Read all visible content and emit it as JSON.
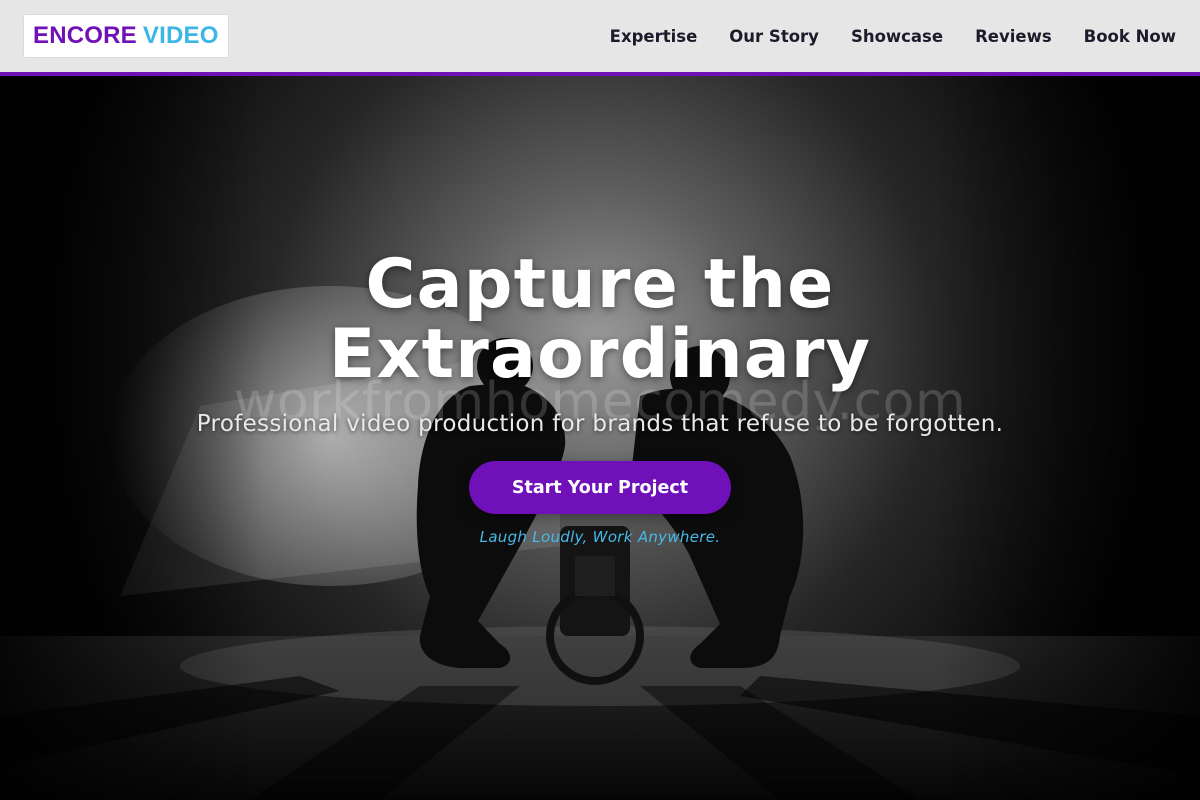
{
  "header": {
    "logo": {
      "word1": "ENCORE",
      "word2": "VIDEO",
      "word1_color": "#7010b8",
      "word2_color": "#3cb6e6"
    },
    "nav": [
      {
        "label": "Expertise"
      },
      {
        "label": "Our Story"
      },
      {
        "label": "Showcase"
      },
      {
        "label": "Reviews"
      },
      {
        "label": "Book Now"
      }
    ],
    "accent_color": "#7010b8"
  },
  "hero": {
    "title_line1": "Capture the",
    "title_line2": "Extraordinary",
    "watermark": "workfromhomecomedy.com",
    "subtitle": "Professional video production for brands that refuse to be forgotten.",
    "cta_label": "Start Your Project",
    "tagline": "Laugh Loudly, Work Anywhere.",
    "background_image": "black-and-white photo of two crouching camera operators silhouetted against studio light"
  },
  "colors": {
    "cta_background": "#7010b8",
    "tagline": "#47b8e8",
    "header_background": "#e6e6e6"
  }
}
